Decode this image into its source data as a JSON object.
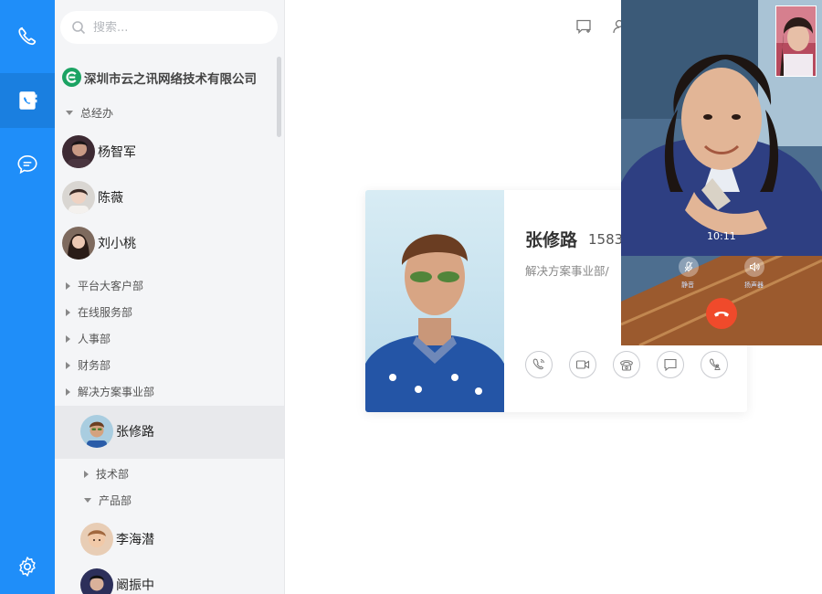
{
  "rail": {
    "items": [
      {
        "icon": "phone-icon"
      },
      {
        "icon": "contacts-book-icon",
        "active": true
      },
      {
        "icon": "chat-bubble-icon"
      },
      {
        "icon": "settings-gear-icon"
      }
    ],
    "accent": "#1f8ef9"
  },
  "search": {
    "placeholder": "搜索..."
  },
  "company": {
    "name": "深圳市云之讯网络技术有限公司"
  },
  "tree": {
    "dept_ceo": "总经办",
    "ceo_members": [
      "杨智军",
      "陈薇",
      "刘小桃"
    ],
    "depts": [
      "平台大客户部",
      "在线服务部",
      "人事部",
      "财务部",
      "解决方案事业部"
    ],
    "solution_members": [
      "张修路"
    ],
    "sub_depts": [
      "技术部",
      "产品部"
    ],
    "product_members": [
      "李海潜",
      "阚振中"
    ]
  },
  "card": {
    "name": "张修路",
    "phone": "1583",
    "dept": "解决方案事业部/",
    "actions": [
      "voice-call-icon",
      "video-call-icon",
      "landline-call-icon",
      "message-icon",
      "conference-icon"
    ]
  },
  "video_call": {
    "timer": "10:11",
    "mute_label": "静音",
    "speaker_label": "扬声器",
    "hangup_color": "#f04a2b"
  },
  "top_icons": [
    "new-chat-icon",
    "add-user-icon"
  ]
}
